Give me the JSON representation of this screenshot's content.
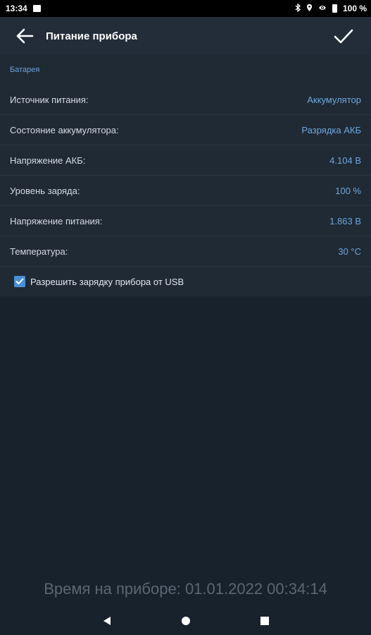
{
  "status_bar": {
    "time": "13:34",
    "battery_percent": "100 %",
    "icons": [
      "image-icon",
      "bluetooth-icon",
      "location-icon",
      "eye-icon",
      "battery-icon"
    ]
  },
  "app_bar": {
    "title": "Питание прибора",
    "back_icon": "arrow-left-icon",
    "confirm_icon": "check-icon"
  },
  "battery_section": {
    "title": "Батарея",
    "rows": [
      {
        "label": "Источник питания:",
        "value": "Аккумулятор"
      },
      {
        "label": "Состояние аккумулятора:",
        "value": "Разрядка АКБ"
      },
      {
        "label": "Напряжение АКБ:",
        "value": "4.104 В"
      },
      {
        "label": "Уровень заряда:",
        "value": "100 %"
      },
      {
        "label": "Напряжение питания:",
        "value": "1.863 В"
      },
      {
        "label": "Температура:",
        "value": "30 °C"
      }
    ],
    "usb_charge": {
      "label": "Разрешить зарядку прибора от USB",
      "checked": true
    }
  },
  "footer": {
    "device_time": "Время на приборе: 01.01.2022 00:34:14"
  },
  "colors": {
    "background": "#18222d",
    "app_bar": "#222d39",
    "panel": "#1f2a35",
    "accent": "#6fa6dd",
    "checkbox": "#4a8fd6"
  }
}
